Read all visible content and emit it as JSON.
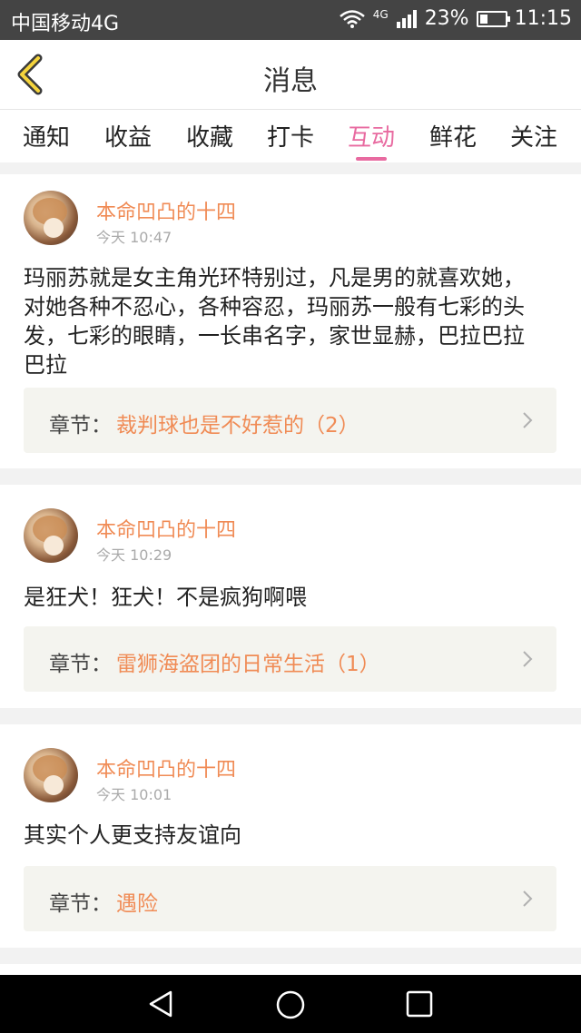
{
  "status_bar": {
    "carrier": "中国移动4G",
    "network": "4G",
    "battery": "23%",
    "time": "11:15"
  },
  "header": {
    "title": "消息",
    "back_icon": "chevron-left-icon"
  },
  "tabs": [
    {
      "label": "通知",
      "active": false
    },
    {
      "label": "收益",
      "active": false
    },
    {
      "label": "收藏",
      "active": false
    },
    {
      "label": "打卡",
      "active": false
    },
    {
      "label": "互动",
      "active": true
    },
    {
      "label": "鲜花",
      "active": false
    },
    {
      "label": "关注",
      "active": false
    }
  ],
  "messages": [
    {
      "username": "本命凹凸的十四",
      "time": "今天 10:47",
      "lines": [
        "玛丽苏就是女主角光环特别过，凡是男的就喜欢她，",
        "对她各种不忍心，各种容忍，玛丽苏一般有七彩的头",
        "发，七彩的眼睛，一长串名字，家世显赫，巴拉巴拉",
        "巴拉"
      ],
      "chapter_label": "章节：",
      "chapter_title": "裁判球也是不好惹的（2）"
    },
    {
      "username": "本命凹凸的十四",
      "time": "今天 10:29",
      "lines": [
        "是狂犬！狂犬！不是疯狗啊喂"
      ],
      "chapter_label": "章节：",
      "chapter_title": "雷狮海盗团的日常生活（1）"
    },
    {
      "username": "本命凹凸的十四",
      "time": "今天 10:01",
      "lines": [
        "其实个人更支持友谊向"
      ],
      "chapter_label": "章节：",
      "chapter_title": "遇险"
    }
  ],
  "colors": {
    "accent": "#e86aa0",
    "username": "#f08b55",
    "status_bar": "#444444"
  }
}
